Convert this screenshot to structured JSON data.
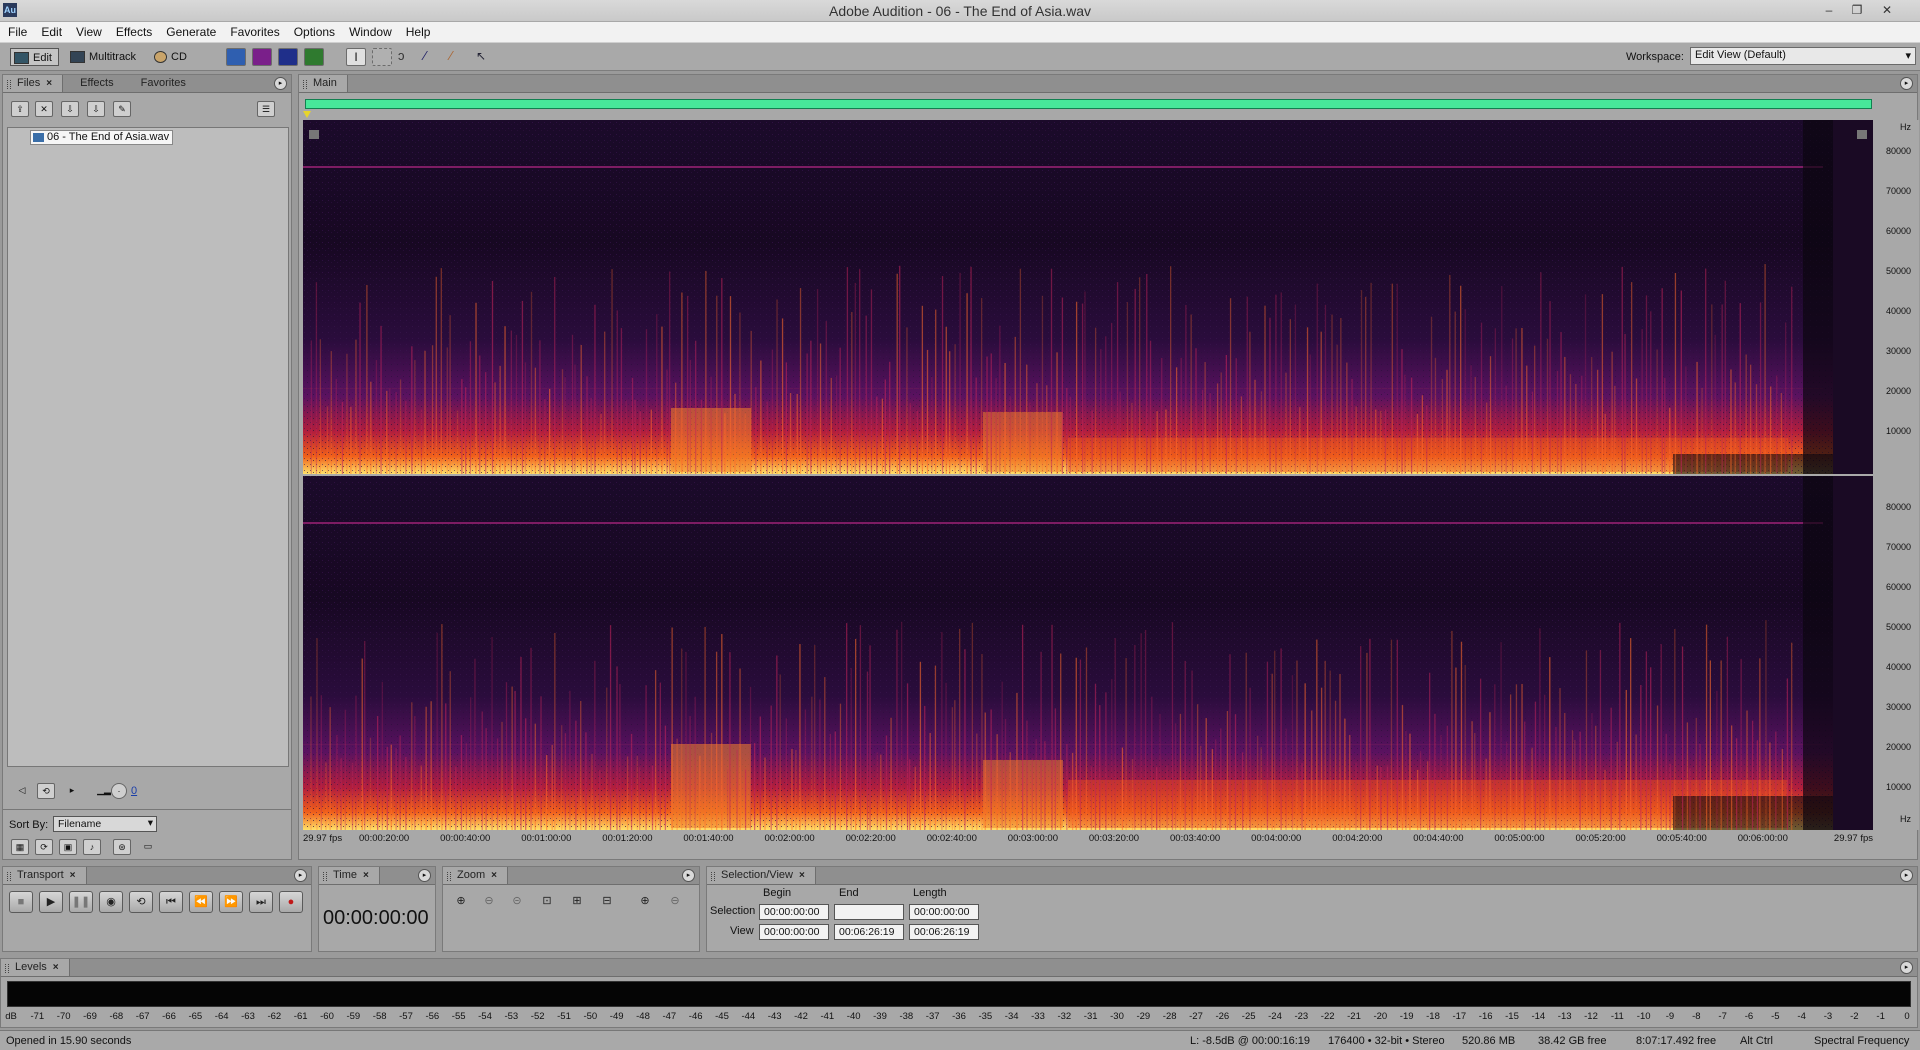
{
  "window": {
    "title": "Adobe Audition - 06 - The End of Asia.wav",
    "logo": "Au",
    "min": "–",
    "restore": "❐",
    "close": "✕"
  },
  "menu": [
    "File",
    "Edit",
    "View",
    "Effects",
    "Generate",
    "Favorites",
    "Options",
    "Window",
    "Help"
  ],
  "toolbar": {
    "edit_label": "Edit",
    "multitrack_label": "Multitrack",
    "cd_label": "CD",
    "workspace_label": "Workspace:",
    "workspace_value": "Edit View (Default)"
  },
  "files_panel": {
    "tabs": [
      {
        "label": "Files",
        "closable": true
      },
      {
        "label": "Effects"
      },
      {
        "label": "Favorites"
      }
    ],
    "file": "06 - The End of Asia.wav",
    "sort_label": "Sort By:",
    "sort_value": "Filename",
    "autoplay_value": "0"
  },
  "main_panel": {
    "tab": "Main",
    "freq_unit": "Hz",
    "freq_labels": [
      "80000",
      "70000",
      "60000",
      "50000",
      "40000",
      "30000",
      "20000",
      "10000"
    ],
    "fps_left": "29.97 fps",
    "fps_right": "29.97 fps",
    "time_labels": [
      "00:00:20:00",
      "00:00:40:00",
      "00:01:00:00",
      "00:01:20:00",
      "00:01:40:00",
      "00:02:00:00",
      "00:02:20:00",
      "00:02:40:00",
      "00:03:00:00",
      "00:03:20:00",
      "00:03:40:00",
      "00:04:00:00",
      "00:04:20:00",
      "00:04:40:00",
      "00:05:00:00",
      "00:05:20:00",
      "00:05:40:00",
      "00:06:00:00"
    ]
  },
  "transport": {
    "title": "Transport"
  },
  "time_panel": {
    "title": "Time",
    "value": "00:00:00:00"
  },
  "zoom_panel": {
    "title": "Zoom"
  },
  "selection_panel": {
    "title": "Selection/View",
    "col_begin": "Begin",
    "col_end": "End",
    "col_length": "Length",
    "row_selection": "Selection",
    "row_view": "View",
    "selection_begin": "00:00:00:00",
    "selection_end": "",
    "selection_length": "00:00:00:00",
    "view_begin": "00:00:00:00",
    "view_end": "00:06:26:19",
    "view_length": "00:06:26:19"
  },
  "levels": {
    "title": "Levels",
    "scale": [
      "dB",
      "-71",
      "-70",
      "-69",
      "-68",
      "-67",
      "-66",
      "-65",
      "-64",
      "-63",
      "-62",
      "-61",
      "-60",
      "-59",
      "-58",
      "-57",
      "-56",
      "-55",
      "-54",
      "-53",
      "-52",
      "-51",
      "-50",
      "-49",
      "-48",
      "-47",
      "-46",
      "-45",
      "-44",
      "-43",
      "-42",
      "-41",
      "-40",
      "-39",
      "-38",
      "-37",
      "-36",
      "-35",
      "-34",
      "-33",
      "-32",
      "-31",
      "-30",
      "-29",
      "-28",
      "-27",
      "-26",
      "-25",
      "-24",
      "-23",
      "-22",
      "-21",
      "-20",
      "-19",
      "-18",
      "-17",
      "-16",
      "-15",
      "-14",
      "-13",
      "-12",
      "-11",
      "-10",
      "-9",
      "-8",
      "-7",
      "-6",
      "-5",
      "-4",
      "-3",
      "-2",
      "-1",
      "0"
    ]
  },
  "status": {
    "opened": "Opened in 15.90 seconds",
    "level": "L: -8.5dB @ 00:00:16:19",
    "format": "176400 • 32-bit • Stereo",
    "size": "520.86 MB",
    "free_disk": "38.42 GB free",
    "free_time": "8:07:17.492 free",
    "modifier": "Alt Ctrl",
    "view_mode": "Spectral Frequency"
  }
}
